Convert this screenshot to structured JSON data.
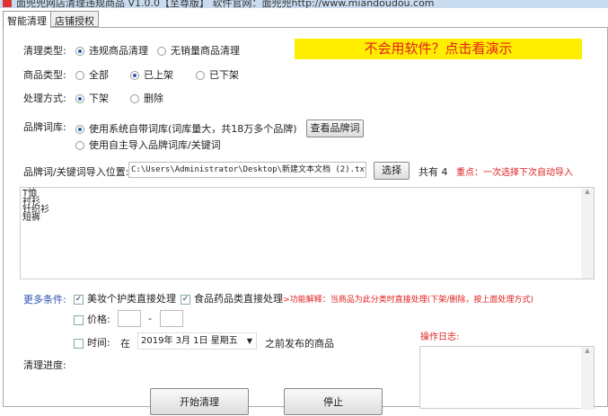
{
  "window": {
    "title": "面兜兜网店清理违规商品 V1.0.0【至尊版】  软件官网：面兜兜http://www.miandoudou.com"
  },
  "tabs": [
    {
      "label": "智能清理"
    },
    {
      "label": "店铺授权"
    }
  ],
  "banner": {
    "text": "不会用软件？点击看演示",
    "bg": "#ffee00",
    "color": "#e02020"
  },
  "clean_type": {
    "label": "清理类型:",
    "options": [
      "违规商品清理",
      "无销量商品清理"
    ],
    "selected": 0
  },
  "product_type": {
    "label": "商品类型:",
    "options": [
      "全部",
      "已上架",
      "已下架"
    ],
    "selected": 1
  },
  "process": {
    "label": "处理方式:",
    "options": [
      "下架",
      "删除"
    ],
    "selected": 0
  },
  "brand": {
    "label": "品牌词库:",
    "options": [
      "使用系统自带词库(词库量大，共18万多个品牌)",
      "使用自主导入品牌词库/关键词"
    ],
    "selected": 0,
    "view_button": "查看品牌词"
  },
  "import": {
    "label": "品牌词/关键词导入位置:",
    "path": "C:\\Users\\Administrator\\Desktop\\新建文本文档 (2).txt",
    "choose_button": "选择",
    "count": "共有 4",
    "hint": "重点：一次选择下次自动导入"
  },
  "keywords": "T恤\n衬衫\n针织衫\n短裤",
  "more": {
    "label": "更多条件:",
    "cosmetics": "美妆个护类直接处理",
    "food": "食品药品类直接处理",
    "explain": "->功能解释：当商品为此分类时直接处理(下架/删除，按上面处理方式)",
    "price_label": "价格:",
    "price_sep": "-",
    "time_label": "时间:",
    "time_prefix": "在",
    "date": "2019年 3月 1日 星期五",
    "time_suffix": "之前发布的商品"
  },
  "progress_label": "清理进度:",
  "log_label": "操作日志:",
  "start_button": "开始清理",
  "stop_button": "停止"
}
